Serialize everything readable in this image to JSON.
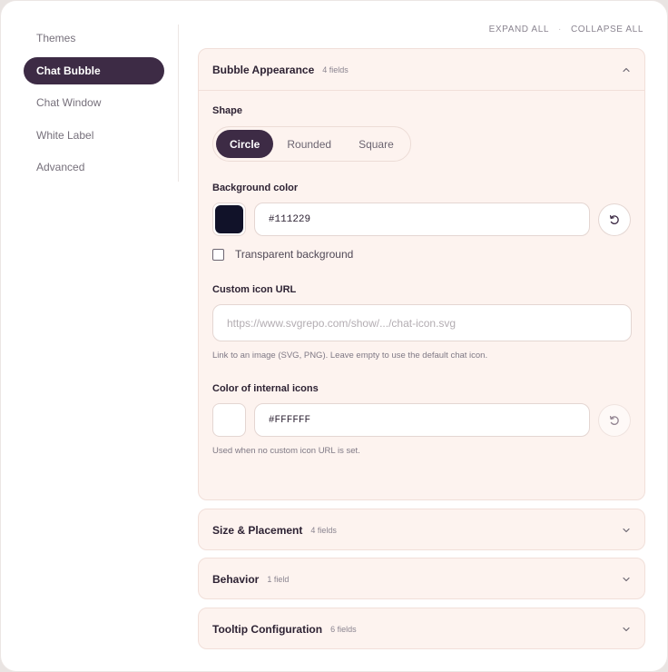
{
  "sidebar": {
    "items": [
      {
        "label": "Themes",
        "active": false
      },
      {
        "label": "Chat Bubble",
        "active": true
      },
      {
        "label": "Chat Window",
        "active": false
      },
      {
        "label": "White Label",
        "active": false
      },
      {
        "label": "Advanced",
        "active": false
      }
    ]
  },
  "actions": {
    "expand_all": "EXPAND ALL",
    "separator": "·",
    "collapse_all": "COLLAPSE ALL"
  },
  "panels": {
    "bubble": {
      "title": "Bubble Appearance",
      "count": "4 fields",
      "shape": {
        "label": "Shape",
        "options": [
          "Circle",
          "Rounded",
          "Square"
        ],
        "selected": "Circle"
      },
      "background": {
        "label": "Background color",
        "value": "#111229",
        "swatch": "#111229"
      },
      "transparent": {
        "label": "Transparent background",
        "checked": false
      },
      "icon_url": {
        "label": "Custom icon URL",
        "placeholder": "https://www.svgrepo.com/show/.../chat-icon.svg",
        "hint": "Link to an image (SVG, PNG). Leave empty to use the default chat icon."
      },
      "internal_icons": {
        "label": "Color of internal icons",
        "value": "#FFFFFF",
        "swatch": "#FFFFFF",
        "hint": "Used when no custom icon URL is set."
      }
    },
    "size": {
      "title": "Size & Placement",
      "count": "4 fields"
    },
    "behavior": {
      "title": "Behavior",
      "count": "1 field"
    },
    "tooltip": {
      "title": "Tooltip Configuration",
      "count": "6 fields"
    }
  },
  "icons": {
    "chevron_up": "chevron-up-icon",
    "chevron_down": "chevron-down-icon",
    "reset": "reset-icon"
  },
  "colors": {
    "accent": "#3d2b45",
    "panel_bg": "#fdf3ef"
  }
}
